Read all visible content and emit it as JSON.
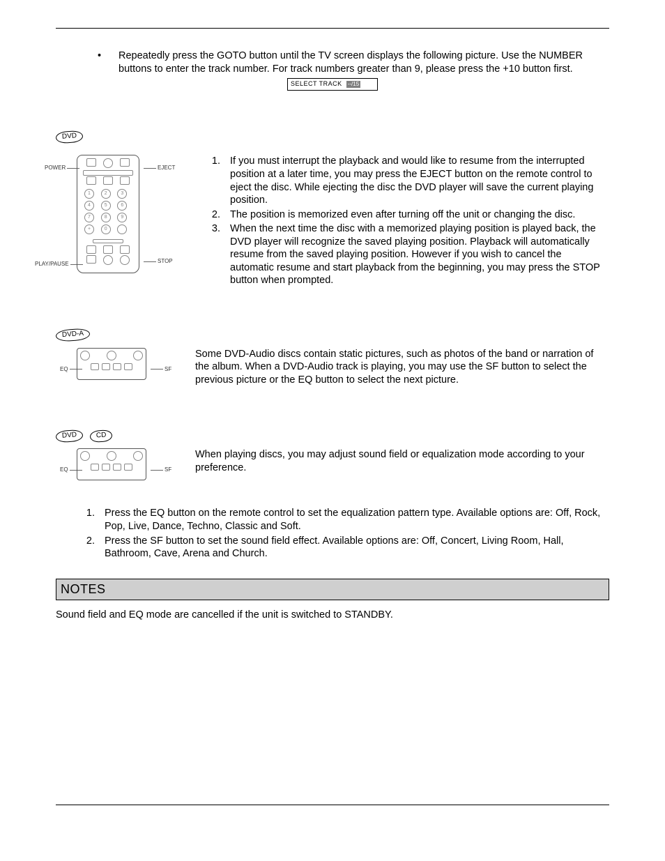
{
  "intro": {
    "bullet": "Repeatedly press the GOTO button until the TV screen displays the following picture.  Use the NUMBER buttons to enter the track number.  For track numbers greater than 9, please press the +10 button first.",
    "select_track_label": "SELECT TRACK",
    "select_track_value": "--/15"
  },
  "section1": {
    "badge": "DVD",
    "remote": {
      "power": "POWER",
      "eject": "EJECT",
      "playpause": "PLAY/PAUSE",
      "stop": "STOP"
    },
    "list": [
      "If you must interrupt the playback and would like to resume from the interrupted position at a later time, you may press the EJECT button on the remote control to eject the disc.  While ejecting the disc the DVD player will save the current playing position.",
      "The position is memorized even after turning off the unit or changing the disc.",
      "When the next time the disc with a memorized playing position is played back, the DVD player will recognize the saved playing position.  Playback will automatically resume from the saved playing position.  However if you wish to cancel the automatic resume and start playback from the beginning, you may press the STOP button when prompted."
    ]
  },
  "section2": {
    "badge": "DVD-A",
    "panel": {
      "eq": "EQ",
      "sf": "SF"
    },
    "para": "Some DVD-Audio discs contain static pictures, such as photos of the band or narration of the album.  When a DVD-Audio track is playing, you may use the SF button to select the previous picture or the EQ button to select the next picture."
  },
  "section3": {
    "badge1": "DVD",
    "badge2": "CD",
    "panel": {
      "eq": "EQ",
      "sf": "SF"
    },
    "para": "When playing discs, you may adjust sound field or equalization mode according to your preference.",
    "list": [
      "Press the EQ button on the remote control to set the equalization pattern type.  Available options are: Off, Rock, Pop, Live, Dance, Techno, Classic and Soft.",
      "Press the SF button to set the sound field effect.  Available options are: Off, Concert, Living Room, Hall, Bathroom, Cave, Arena and Church."
    ]
  },
  "notes": {
    "heading": "NOTES",
    "text": "Sound field and EQ mode are cancelled if the unit is switched to STANDBY."
  }
}
